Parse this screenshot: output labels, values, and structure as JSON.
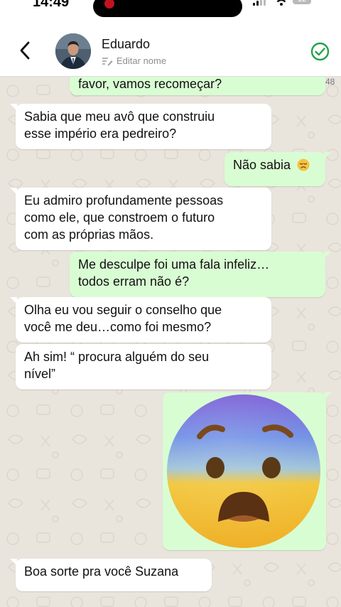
{
  "status_bar": {
    "time": "14:49",
    "battery": "12"
  },
  "header": {
    "back_icon": "chevron-left-icon",
    "contact_name": "Eduardo",
    "edit_label": "Editar nome",
    "verified_icon": "check-circle-icon",
    "accent": "#22a447"
  },
  "chat": {
    "peek_time": "48",
    "messages": [
      {
        "from": "out",
        "text": "favor, vamos recomeçar?"
      },
      {
        "from": "in",
        "lines": [
          "Sabia que meu avô que construiu",
          "esse império era pedreiro?"
        ]
      },
      {
        "from": "out",
        "text": "Não sabia",
        "emoji": "disappointed-face"
      },
      {
        "from": "in",
        "lines": [
          "Eu admiro profundamente pessoas",
          "como ele, que constroem o futuro",
          "com as próprias mãos."
        ]
      },
      {
        "from": "out",
        "lines": [
          "Me desculpe foi uma fala infeliz…",
          "todos erram não é?"
        ]
      },
      {
        "from": "in",
        "lines": [
          "Olha eu vou seguir o conselho que",
          "você me deu…como foi mesmo?"
        ]
      },
      {
        "from": "in",
        "lines": [
          "Ah sim! “ procura alguém do seu",
          "nível”"
        ]
      },
      {
        "from": "out",
        "sticker": "fearful-screaming-face"
      },
      {
        "from": "in",
        "text": "Boa sorte pra você Suzana"
      }
    ]
  },
  "colors": {
    "incoming": "#ffffff",
    "outgoing": "#d9fdd3",
    "wallpaper": "#e9e4dc"
  }
}
